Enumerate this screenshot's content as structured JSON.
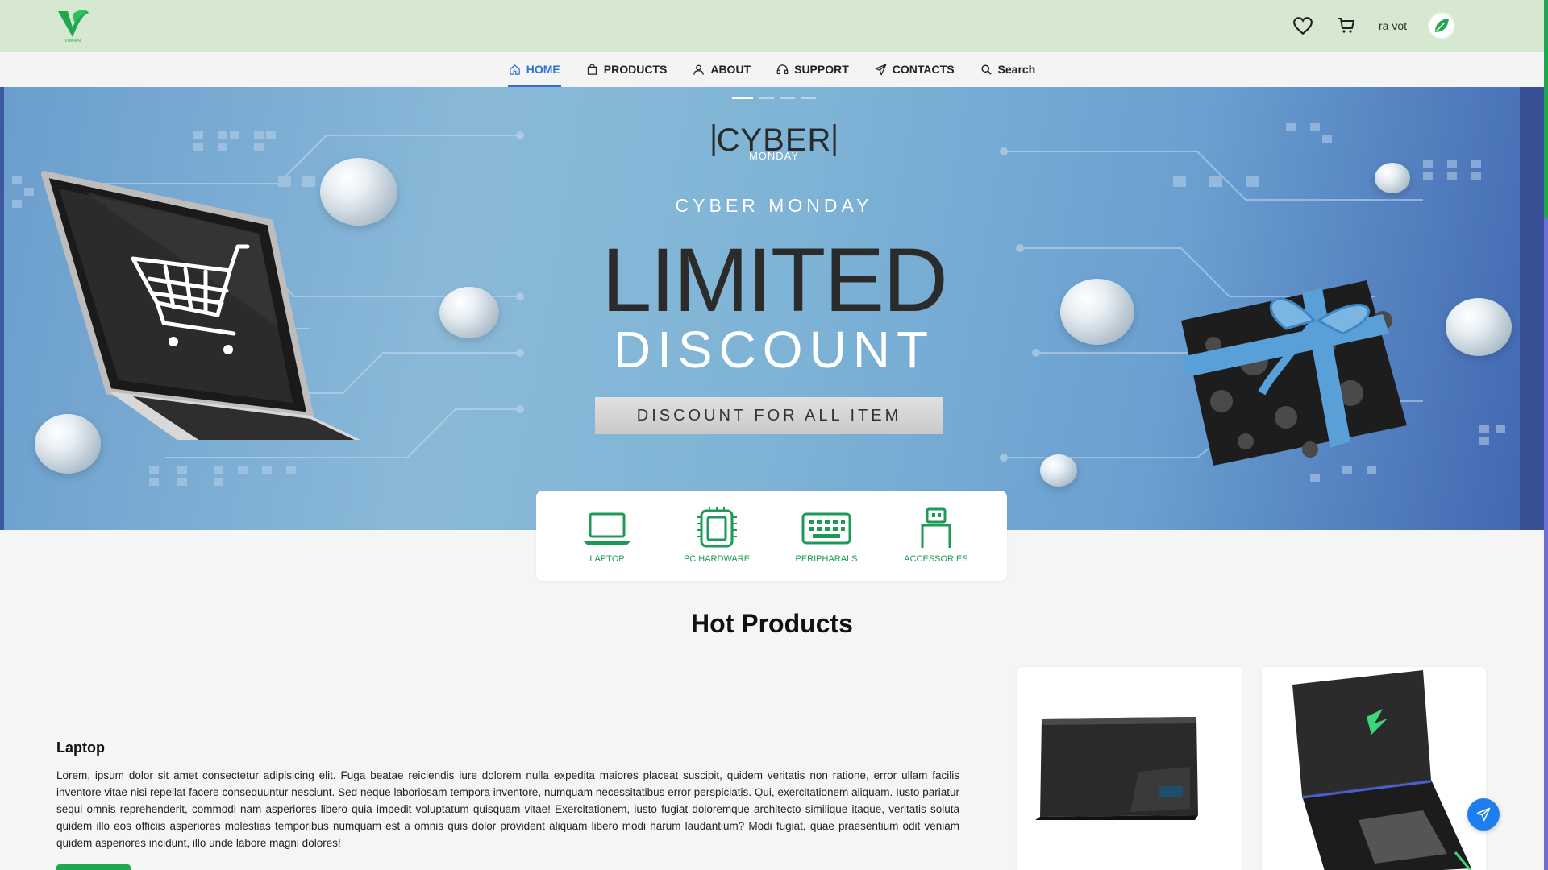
{
  "header": {
    "logo_text": "VIMOAN",
    "username": "ra vot"
  },
  "nav": {
    "items": [
      {
        "label": "HOME",
        "icon": "home-icon",
        "active": true
      },
      {
        "label": "PRODUCTS",
        "icon": "bag-icon"
      },
      {
        "label": "ABOUT",
        "icon": "user-icon"
      },
      {
        "label": "SUPPORT",
        "icon": "headset-icon"
      },
      {
        "label": "CONTACTS",
        "icon": "send-icon"
      },
      {
        "label": "Search",
        "icon": "search-icon"
      }
    ]
  },
  "hero": {
    "logo_big": "CYBER",
    "logo_small": "MONDAY",
    "subtitle": "CYBER MONDAY",
    "headline": "LIMITED",
    "headline2": "DISCOUNT",
    "button_label": "DISCOUNT FOR ALL ITEM",
    "slides": 4,
    "active_slide": 1
  },
  "categories": [
    {
      "label": "LAPTOP",
      "icon": "laptop-icon"
    },
    {
      "label": "PC HARDWARE",
      "icon": "chip-icon"
    },
    {
      "label": "PERIPHARALS",
      "icon": "keyboard-icon"
    },
    {
      "label": "ACCESSORIES",
      "icon": "usb-icon"
    }
  ],
  "hot_products": {
    "title": "Hot Products",
    "featured_title": "Laptop",
    "featured_description": "Lorem, ipsum dolor sit amet consectetur adipisicing elit. Fuga beatae reiciendis iure dolorem nulla expedita maiores placeat suscipit, quidem veritatis non ratione, error ullam facilis inventore vitae nisi repellat facere consequuntur nesciunt. Sed neque laboriosam tempora inventore, numquam necessitatibus error perspiciatis. Qui, exercitationem aliquam. Iusto pariatur sequi omnis reprehenderit, commodi nam asperiores libero quia impedit voluptatum quisquam vitae! Exercitationem, iusto fugiat doloremque architecto similique itaque, veritatis soluta quidem illo eos officiis asperiores molestias temporibus numquam est a omnis quis dolor provident aliquam libero modi harum laudantium? Modi fugiat, quae praesentium odit veniam quidem asperiores incidunt, illo unde labore magni dolores!"
  },
  "colors": {
    "brand_green": "#1fa84f",
    "topbar": "#d6e8cf",
    "active_blue": "#2f6fd6"
  }
}
